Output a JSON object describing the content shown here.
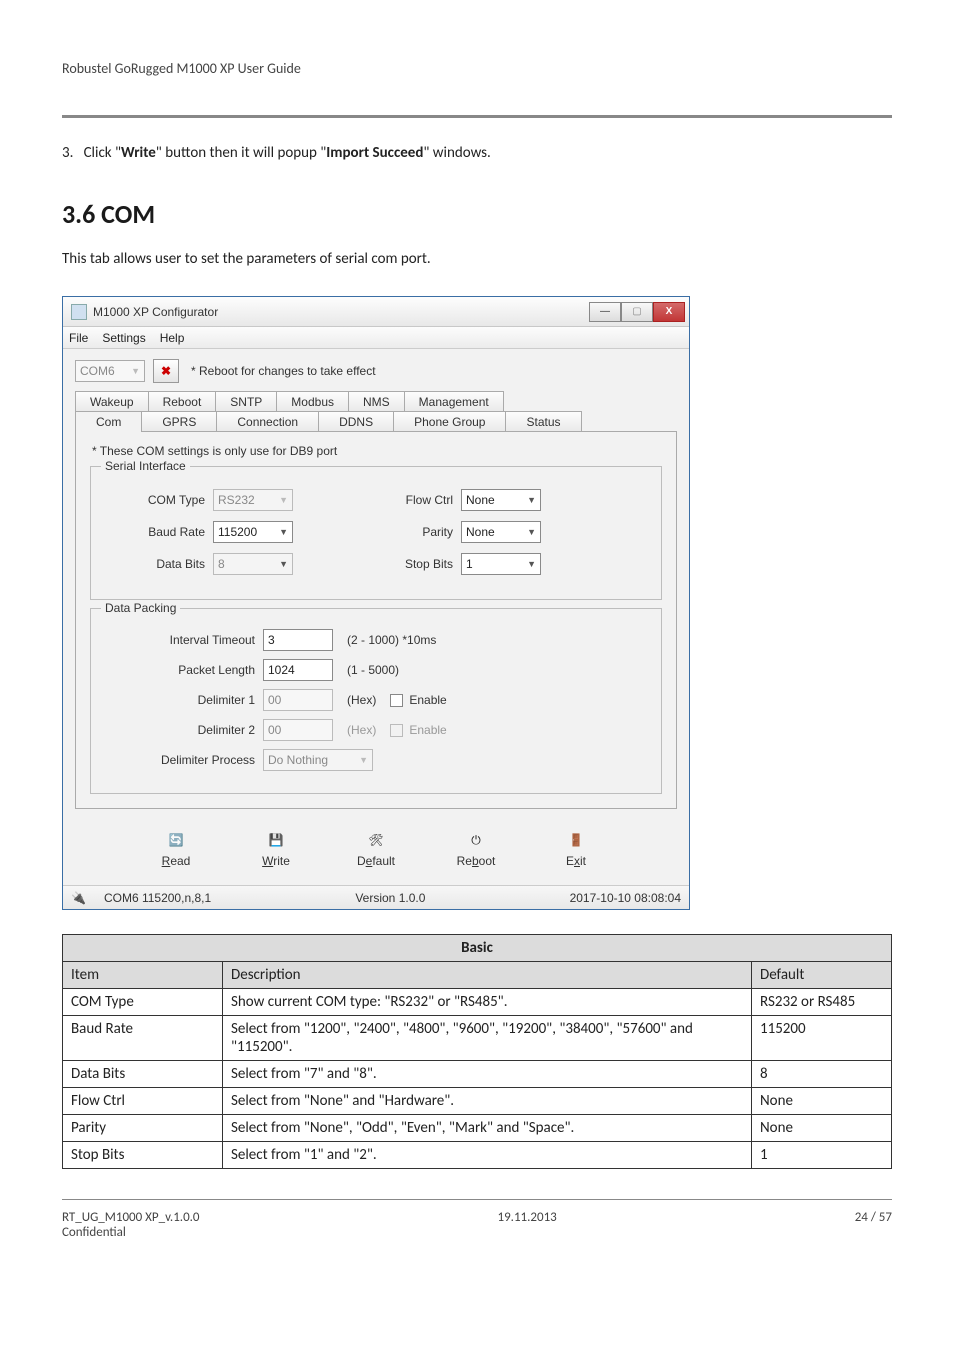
{
  "header": "Robustel GoRugged M1000 XP User Guide",
  "step3": "3.   Click \"Write\" button then it will popup \"Import Succeed\" windows.",
  "h2": "3.6    COM",
  "intro": "This tab allows user to set the parameters of serial com port.",
  "win": {
    "title": "M1000 XP Configurator",
    "close_x": "X"
  },
  "menu": {
    "file": "File",
    "settings": "Settings",
    "help": "Help"
  },
  "toolbar": {
    "port": "COM6",
    "x": "✖",
    "reboot_note": "* Reboot for changes to take effect"
  },
  "tabs1": [
    "Wakeup",
    "Reboot",
    "SNTP",
    "Modbus",
    "NMS",
    "Management"
  ],
  "tabs2": [
    "Com",
    "GPRS",
    "Connection",
    "DDNS",
    "Phone Group",
    "Status"
  ],
  "pane": {
    "note": "* These COM settings is only use for DB9 port",
    "serial_title": "Serial Interface",
    "com_type_lbl": "COM Type",
    "com_type_val": "RS232",
    "baud_lbl": "Baud Rate",
    "baud_val": "115200",
    "databits_lbl": "Data Bits",
    "databits_val": "8",
    "flow_lbl": "Flow Ctrl",
    "flow_val": "None",
    "parity_lbl": "Parity",
    "parity_val": "None",
    "stop_lbl": "Stop Bits",
    "stop_val": "1",
    "dp_title": "Data Packing",
    "interval_lbl": "Interval Timeout",
    "interval_val": "3",
    "interval_after": "(2 - 1000) *10ms",
    "pktlen_lbl": "Packet Length",
    "pktlen_val": "1024",
    "pktlen_after": "(1 - 5000)",
    "del1_lbl": "Delimiter 1",
    "del1_val": "00",
    "hex": "(Hex)",
    "enable": "Enable",
    "del2_lbl": "Delimiter 2",
    "del2_val": "00",
    "delproc_lbl": "Delimiter Process",
    "delproc_val": "Do Nothing"
  },
  "bottom": {
    "read": "Read",
    "write": "Write",
    "default": "Default",
    "reboot": "Reboot",
    "exit": "Exit"
  },
  "status": {
    "port": "COM6 115200,n,8,1",
    "ver": "Version 1.0.0",
    "time": "2017-10-10 08:08:04"
  },
  "table": {
    "title": "Basic",
    "h_item": "Item",
    "h_desc": "Description",
    "h_def": "Default",
    "rows": [
      {
        "item": "COM Type",
        "desc": "Show current COM type: \"RS232\" or \"RS485\".",
        "def": "RS232 or RS485"
      },
      {
        "item": "Baud Rate",
        "desc": "Select from \"1200\", \"2400\", \"4800\", \"9600\", \"19200\", \"38400\", \"57600\" and \"115200\".",
        "def": "115200"
      },
      {
        "item": "Data Bits",
        "desc": "Select from \"7\" and \"8\".",
        "def": "8"
      },
      {
        "item": "Flow Ctrl",
        "desc": "Select from \"None\" and \"Hardware\".",
        "def": "None"
      },
      {
        "item": "Parity",
        "desc": "Select from \"None\", \"Odd\", \"Even\", \"Mark\" and \"Space\".",
        "def": "None"
      },
      {
        "item": "Stop Bits",
        "desc": "Select from \"1\" and \"2\".",
        "def": "1"
      }
    ]
  },
  "footer": {
    "left1": "RT_UG_M1000 XP_v.1.0.0",
    "left2": "Confidential",
    "mid": "19.11.2013",
    "right": "24 / 57"
  }
}
